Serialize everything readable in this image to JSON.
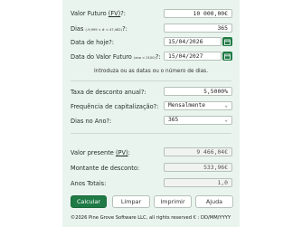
{
  "future_value": {
    "label": "Valor Futuro",
    "label_fv": "(FV)",
    "suffix": "?:",
    "value": "10 000,00€"
  },
  "days": {
    "label": "Dias",
    "range": "(-9,999 < # < 47,482)",
    "suffix": "?:",
    "value": "365"
  },
  "date_today": {
    "label": "Data de hoje?:",
    "value": "15/04/2026",
    "icon": "calendar-icon"
  },
  "date_future": {
    "label": "Data do Valor Futuro",
    "range": "(ano < 2100)",
    "suffix": "?:",
    "value": "15/04/2027",
    "icon": "calendar-icon"
  },
  "instruction": "Introduza ou as datas ou o número de dias.",
  "discount_rate": {
    "label": "Taxa de desconto anual?:",
    "value": "5,5000%"
  },
  "cap_freq": {
    "label": "Frequência de capitalização?:",
    "value": "Mensalmente"
  },
  "days_year": {
    "label": "Dias no Ano?:",
    "value": "365"
  },
  "present_value": {
    "label": "Valor presente",
    "label_pv": "(PV)",
    "suffix": ":",
    "value": "9 466,04€"
  },
  "discount_amount": {
    "label": "Montante de desconto:",
    "value": "533,96€"
  },
  "years_total": {
    "label": "Anos Totais:",
    "value": "1,0"
  },
  "buttons": {
    "calc": "Calcular",
    "clear": "Limpar",
    "print": "Imprimir",
    "help": "Ajuda"
  },
  "footer": "©2026 Pine Grove Software LLC, all rights reserved  € : DD/MM/YYYY",
  "colors": {
    "accent": "#1f7a45",
    "panel_bg": "#eaf4ee"
  }
}
